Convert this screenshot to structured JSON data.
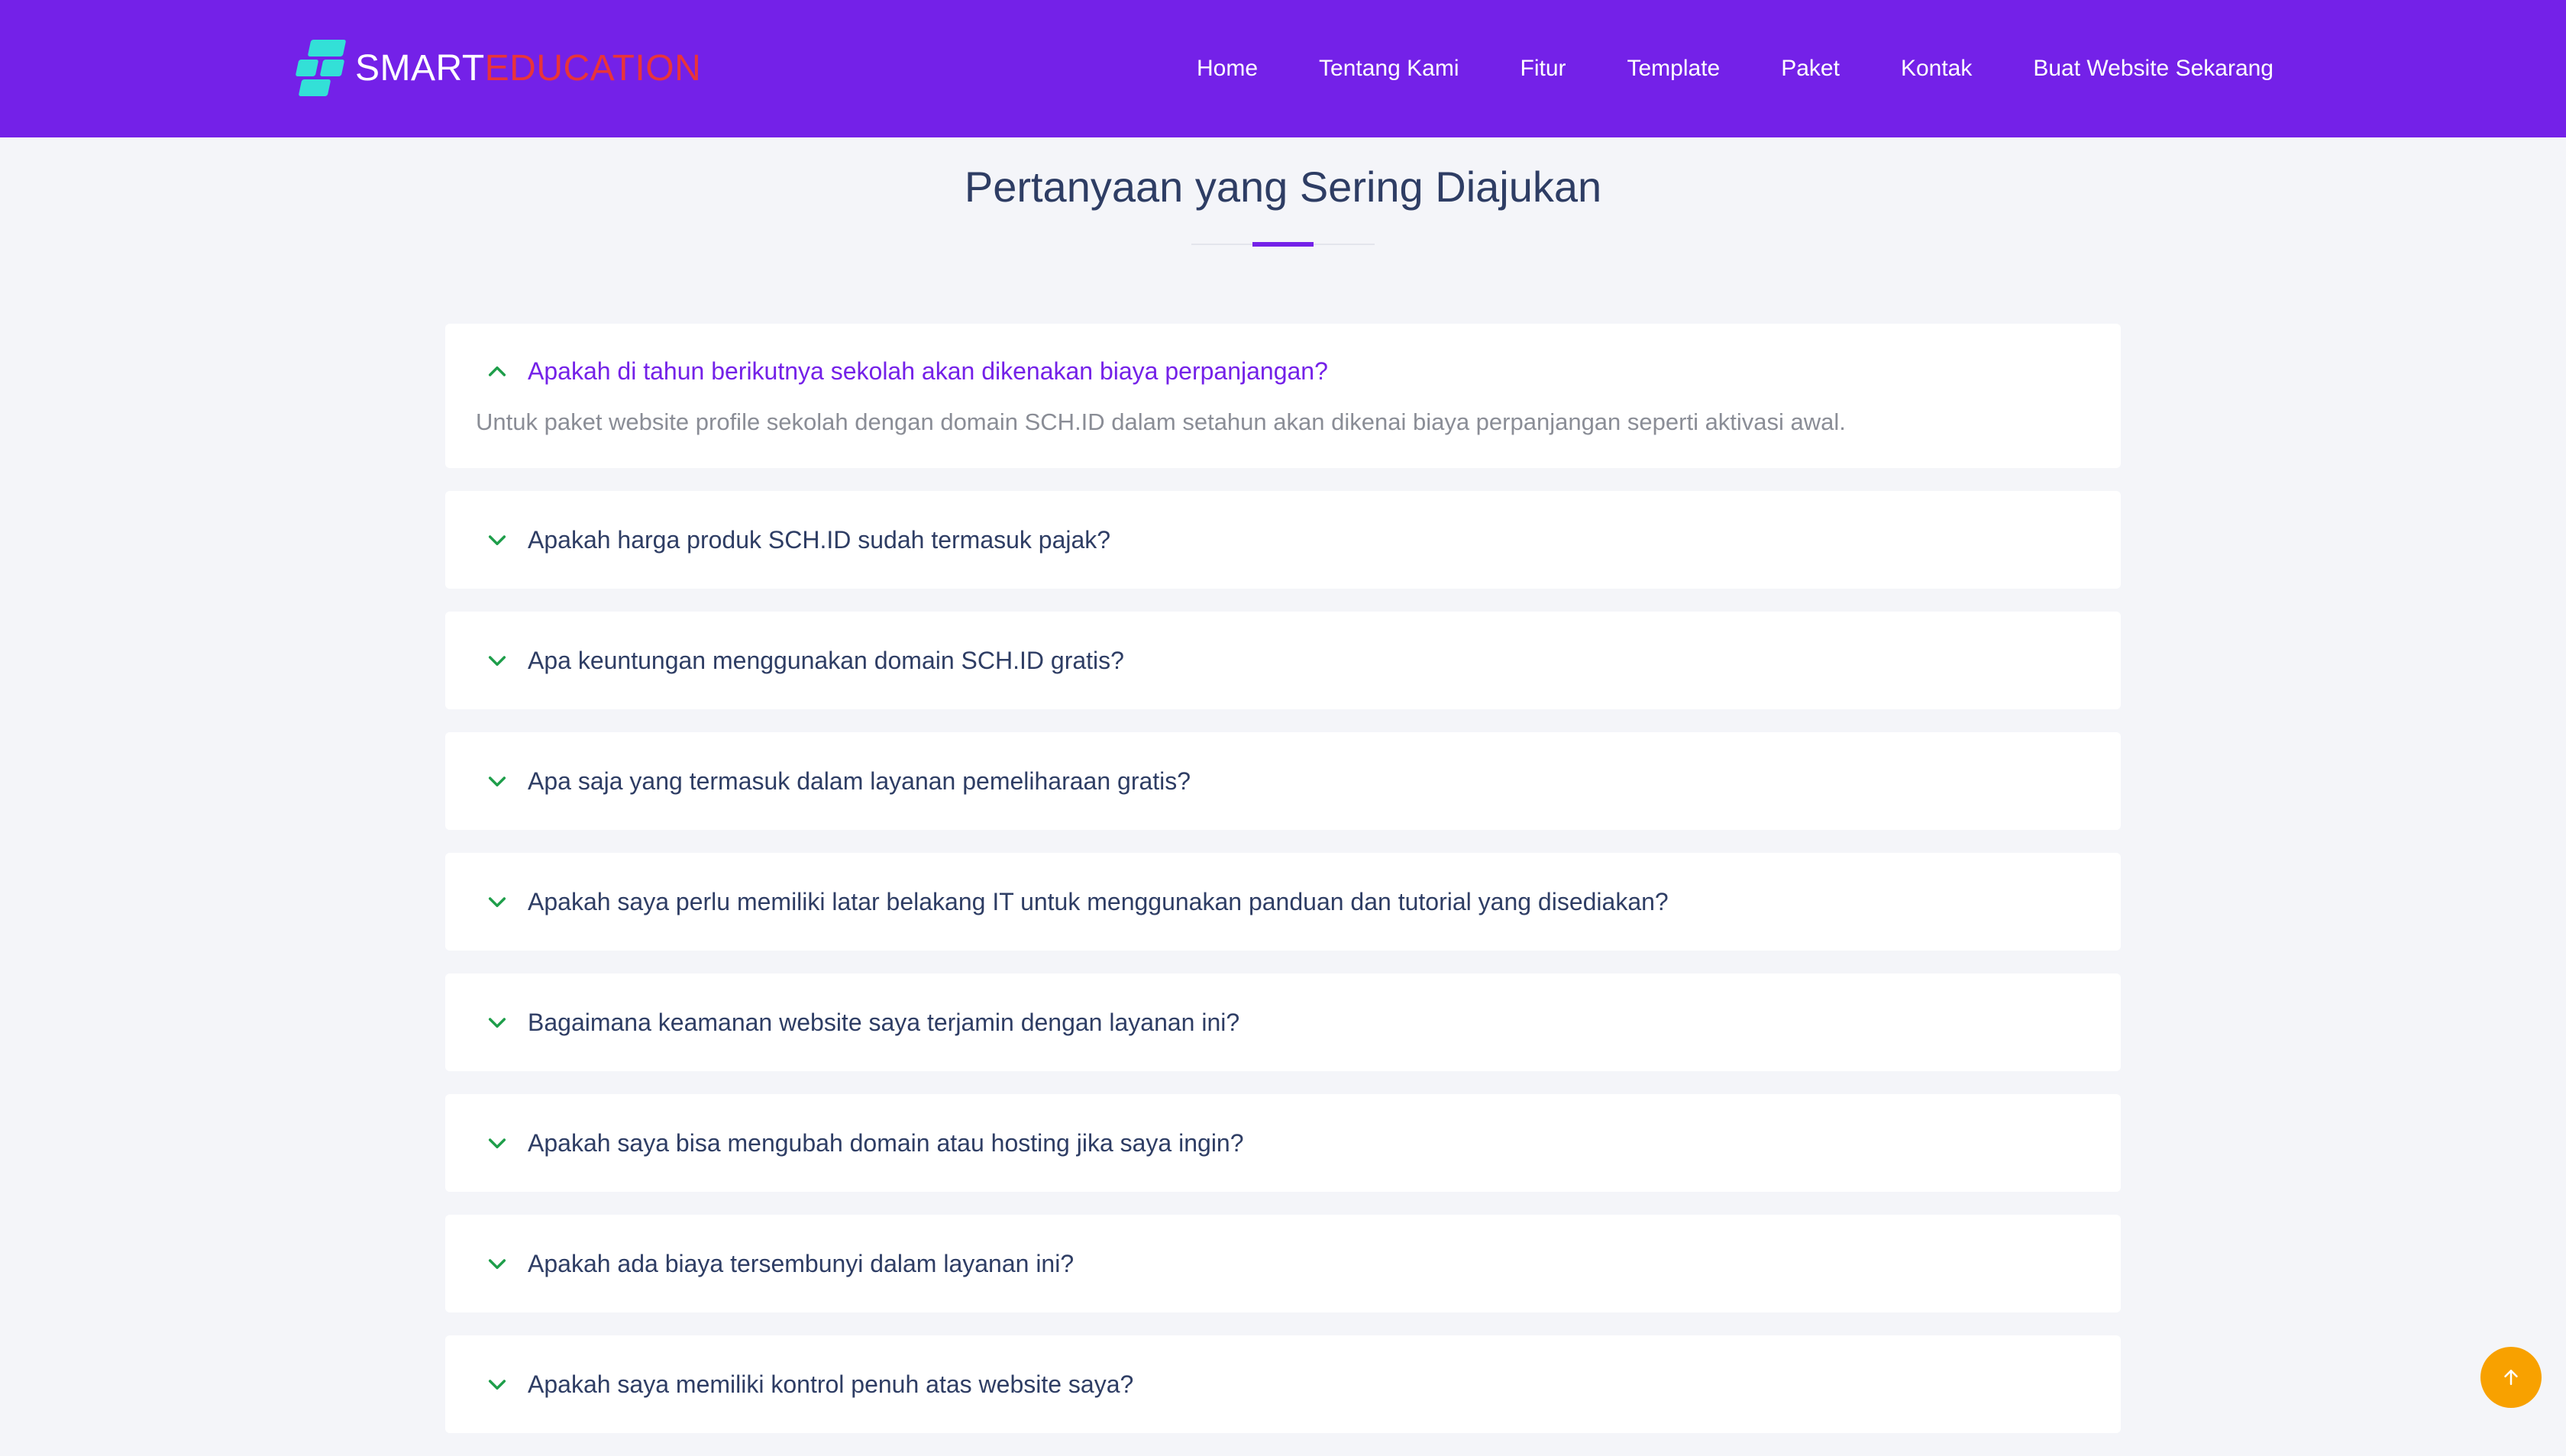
{
  "brand": {
    "part1": "SMART",
    "part2": "EDUCATION"
  },
  "nav": {
    "items": [
      "Home",
      "Tentang Kami",
      "Fitur",
      "Template",
      "Paket",
      "Kontak",
      "Buat Website Sekarang"
    ]
  },
  "section": {
    "title": "Pertanyaan yang Sering Diajukan"
  },
  "faq": {
    "items": [
      {
        "question": "Apakah di tahun berikutnya sekolah akan dikenakan biaya perpanjangan?",
        "answer": "Untuk paket website profile sekolah dengan domain SCH.ID dalam setahun akan dikenai biaya perpanjangan seperti aktivasi awal.",
        "expanded": true
      },
      {
        "question": "Apakah harga produk SCH.ID sudah termasuk pajak?",
        "expanded": false
      },
      {
        "question": "Apa keuntungan menggunakan domain SCH.ID gratis?",
        "expanded": false
      },
      {
        "question": "Apa saja yang termasuk dalam layanan pemeliharaan gratis?",
        "expanded": false
      },
      {
        "question": "Apakah saya perlu memiliki latar belakang IT untuk menggunakan panduan dan tutorial yang disediakan?",
        "expanded": false
      },
      {
        "question": "Bagaimana keamanan website saya terjamin dengan layanan ini?",
        "expanded": false
      },
      {
        "question": "Apakah saya bisa mengubah domain atau hosting jika saya ingin?",
        "expanded": false
      },
      {
        "question": "Apakah ada biaya tersembunyi dalam layanan ini?",
        "expanded": false
      },
      {
        "question": "Apakah saya memiliki kontrol penuh atas website saya?",
        "expanded": false
      }
    ]
  },
  "colors": {
    "header_bg": "#7421e8",
    "accent": "#7421e8",
    "logo_edu": "#e8343a",
    "logo_mark": "#33e0d7",
    "chevron": "#1e9e4a",
    "back_to_top": "#f8a100"
  },
  "icons": {
    "expanded": "chevron-up-icon",
    "collapsed": "chevron-down-icon",
    "back_to_top": "arrow-up-icon"
  }
}
